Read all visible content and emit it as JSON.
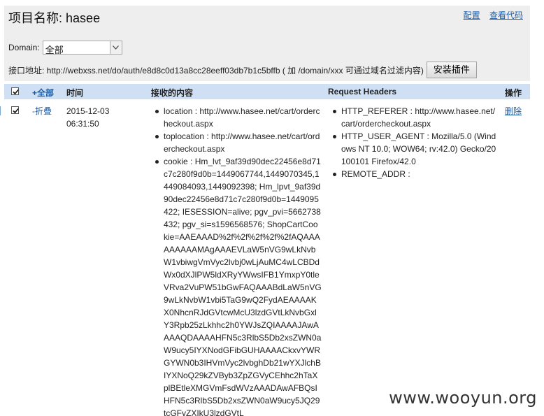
{
  "header": {
    "title_prefix": "项目名称:",
    "project_name": "hasee",
    "config_link": "配置",
    "view_code_link": "查看代码"
  },
  "domain": {
    "label": "Domain:",
    "selected": "全部"
  },
  "api": {
    "text": "接口地址: http://webxss.net/do/auth/e8d8c0d13a8cc28eeff03db7b1c5bffb ( 加 /domain/xxx 可通过域名过滤内容)",
    "install_button": "安装插件"
  },
  "table": {
    "columns": {
      "expand_all": "+全部",
      "time": "时间",
      "content": "接收的内容",
      "headers": "Request Headers",
      "action": "操作"
    },
    "rows": [
      {
        "toggle": "-折叠",
        "date": "2015-12-03",
        "time": "06:31:50",
        "content": [
          "location : http://www.hasee.net/cart/ordercheckout.aspx",
          "toplocation : http://www.hasee.net/cart/ordercheckout.aspx",
          "cookie : Hm_lvt_9af39d90dec22456e8d71c7c280f9d0b=1449067744,1449070345,1449084093,1449092398; Hm_lpvt_9af39d90dec22456e8d71c7c280f9d0b=1449095422; IESESSION=alive; pgv_pvi=5662738432; pgv_si=s1596568576; ShopCartCookie=AAEAAAD%2f%2f%2f%2f%2fAQAAAAAAAAAMAgAAAEVLaW5nVG9wLkNvbW1vbiwgVmVyc2lvbj0wLjAuMC4wLCBDdWx0dXJlPW5ldXRyYWwsIFB1YmxpY0tleVRva2VuPW51bGwFAQAAABdLaW5nVG9wLkNvbW1vbi5TaG9wQ2FydAEAAAAKX0NhcnRJdGVtcwMcU3lzdGVtLkNvbGxlY3Rpb25zLkhhc2h0YWJsZQIAAAAJAwAAAAQDAAAAHFN5c3RlbS5Db2xsZWN0aW9ucy5IYXNodGFibGUHAAAACkxvYWRGYWN0b3IHVmVyc2lvbghDb21wYXJlchBIYXNoQ29kZVByb3ZpZGVyCEhhc2hTaXplBEtleXMGVmFsdWVzAAADAwAFBQsIHFN5c3RlbS5Db2xsZWN0aW9ucy5JQ29tcGFyZXIkU3lzdGVtL"
        ],
        "headers": [
          "HTTP_REFERER : http://www.hasee.net/cart/ordercheckout.aspx",
          "HTTP_USER_AGENT : Mozilla/5.0 (Windows NT 10.0; WOW64; rv:42.0) Gecko/20100101 Firefox/42.0",
          "REMOTE_ADDR :"
        ],
        "delete": "删除"
      }
    ]
  },
  "watermark": "www.wooyun.org"
}
